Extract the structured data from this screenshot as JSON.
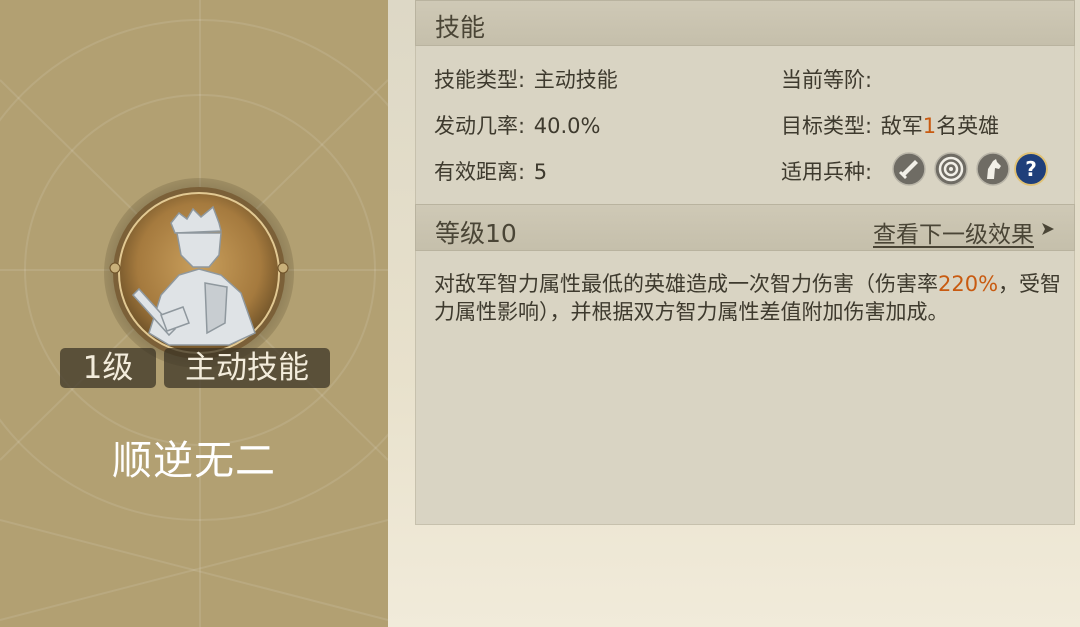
{
  "skill": {
    "level_badge": "1级",
    "type_badge": "主动技能",
    "name": "顺逆无二"
  },
  "section_skill": {
    "title": "技能"
  },
  "info": {
    "type_label": "技能类型:",
    "type_value": "主动技能",
    "chance_label": "发动几率:",
    "chance_value": "40.0%",
    "range_label": "有效距离:",
    "range_value": "5",
    "current_tier_label": "当前等阶:",
    "target_label": "目标类型:",
    "target_prefix": "敌军",
    "target_count": "1",
    "target_suffix": "名英雄",
    "troop_label": "适用兵种:"
  },
  "troop_icons": [
    "sword-icon",
    "archer-target-icon",
    "cavalry-horse-icon",
    "question-mark-icon"
  ],
  "section_level": {
    "title": "等级10",
    "next_link": "查看下一级效果"
  },
  "description": {
    "part1": "对敌军智力属性最低的英雄造成一次智力伤害（伤害率",
    "damage_rate": "220%",
    "part2": "，受智力属性影响），并根据双方智力属性差值附加伤害加成。"
  },
  "colors": {
    "highlight": "#c85a10",
    "left_panel": "#b2a072"
  }
}
